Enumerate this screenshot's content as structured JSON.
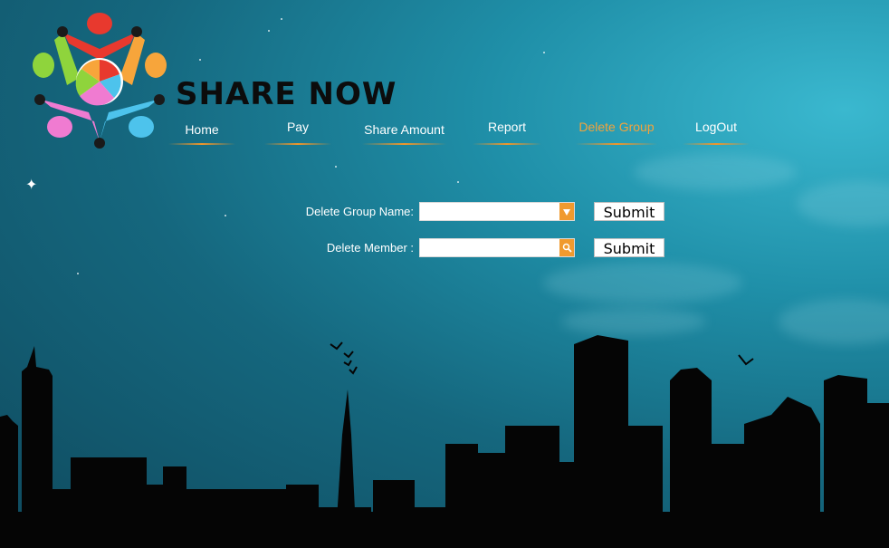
{
  "brand": {
    "name": "SHARE NOW"
  },
  "nav": {
    "items": [
      {
        "label": "Home"
      },
      {
        "label": "Pay"
      },
      {
        "label": "Share Amount"
      },
      {
        "label": "Report"
      },
      {
        "label": "Delete Group",
        "active": true
      },
      {
        "label": "LogOut"
      }
    ]
  },
  "form": {
    "delete_group": {
      "label": "Delete Group Name:",
      "value": "",
      "button_icon": "chevron-down-icon",
      "submit_label": "Submit"
    },
    "delete_member": {
      "label": "Delete Member :",
      "value": "",
      "button_icon": "search-icon",
      "submit_label": "Submit"
    }
  },
  "colors": {
    "accent": "#f0962a",
    "active_nav": "#f2a33c",
    "brand_text": "#0c0c0c"
  }
}
